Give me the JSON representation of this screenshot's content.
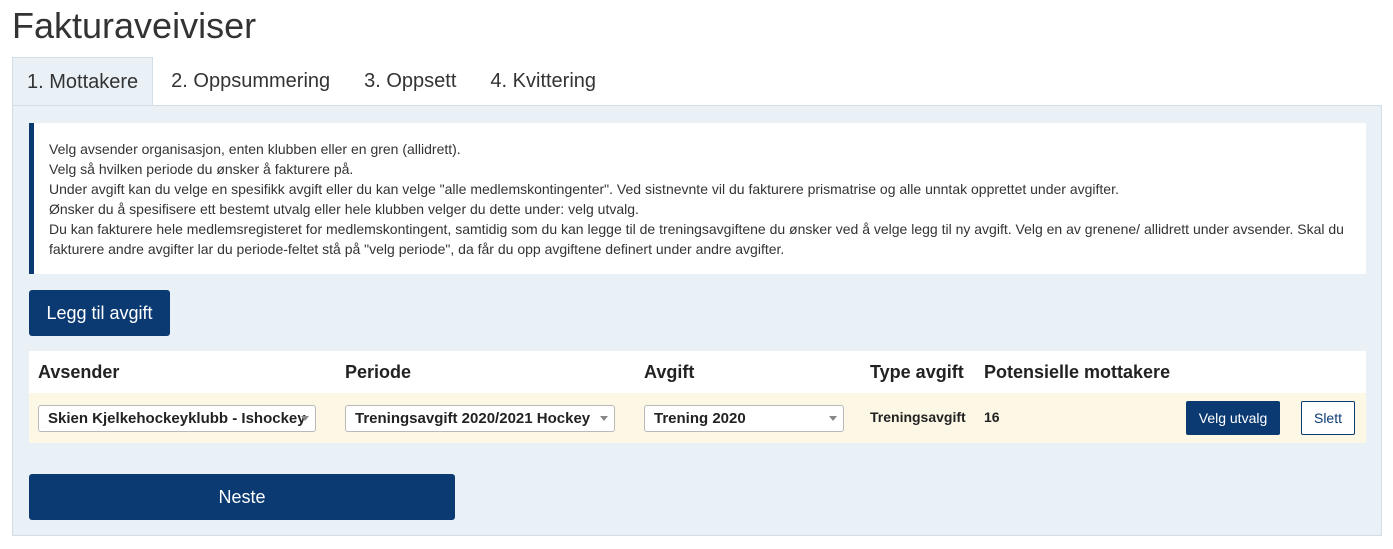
{
  "page": {
    "title": "Fakturaveiviser"
  },
  "tabs": [
    {
      "label": "1. Mottakere",
      "active": true
    },
    {
      "label": "2. Oppsummering",
      "active": false
    },
    {
      "label": "3. Oppsett",
      "active": false
    },
    {
      "label": "4. Kvittering",
      "active": false
    }
  ],
  "info": {
    "lines": [
      "Velg avsender organisasjon, enten klubben eller en gren (allidrett).",
      "Velg så hvilken periode du ønsker å fakturere på.",
      "Under avgift kan du velge en spesifikk avgift eller du kan velge \"alle medlemskontingenter\". Ved sistnevnte vil du fakturere prismatrise og alle unntak opprettet under avgifter.",
      "Ønsker du å spesifisere ett bestemt utvalg eller hele klubben velger du dette under: velg utvalg.",
      "Du kan fakturere hele medlemsregisteret for medlemskontingent, samtidig som du kan legge til de treningsavgiftene du ønsker ved å velge legg til ny avgift. Velg en av grenene/ allidrett under avsender. Skal du",
      "fakturere andre avgifter lar du periode-feltet stå på \"velg periode\", da får du opp avgiftene definert under andre avgifter."
    ]
  },
  "buttons": {
    "add_fee": "Legg til avgift",
    "next": "Neste"
  },
  "table": {
    "headers": {
      "sender": "Avsender",
      "period": "Periode",
      "fee": "Avgift",
      "fee_type": "Type avgift",
      "recipients": "Potensielle mottakere"
    },
    "rows": [
      {
        "sender": "Skien Kjelkehockeyklubb - Ishockey",
        "period": "Treningsavgift 2020/2021 Hockey",
        "fee": "Trening 2020",
        "fee_type": "Treningsavgift",
        "recipients": "16",
        "select_label": "Velg utvalg",
        "delete_label": "Slett"
      }
    ]
  },
  "colors": {
    "primary": "#0b3a73",
    "panel_bg": "#e9f1f7",
    "row_bg": "#fdf8e6"
  }
}
